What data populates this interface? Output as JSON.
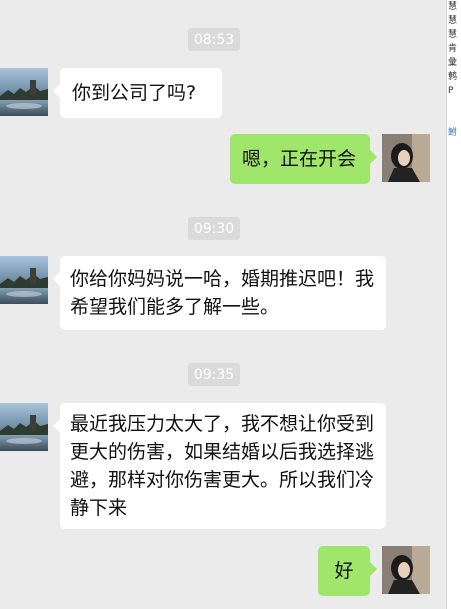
{
  "chat": {
    "messages": [
      {
        "type": "time",
        "text": "08:53"
      },
      {
        "type": "received",
        "text": "你到公司了吗?"
      },
      {
        "type": "sent",
        "text": "嗯，正在开会"
      },
      {
        "type": "time",
        "text": "09:30"
      },
      {
        "type": "received",
        "text": "你给你妈妈说一哈，婚期推迟吧！我希望我们能多了解一些。"
      },
      {
        "type": "time",
        "text": "09:35"
      },
      {
        "type": "received",
        "text": "最近我压力太大了，我不想让你受到更大的伤害，如果结婚以后我选择逃避，那样对你伤害更大。所以我们冷静下来"
      },
      {
        "type": "sent",
        "text": "好"
      }
    ]
  },
  "sidebar": {
    "fragments": [
      "慧",
      "慧",
      "慧",
      "肯",
      "彙",
      "鹩",
      "P",
      "",
      "",
      "鲋"
    ]
  },
  "colors": {
    "background": "#ebebeb",
    "sent_bubble": "#9fe66b",
    "received_bubble": "#ffffff",
    "timestamp_bg": "#dadada"
  }
}
